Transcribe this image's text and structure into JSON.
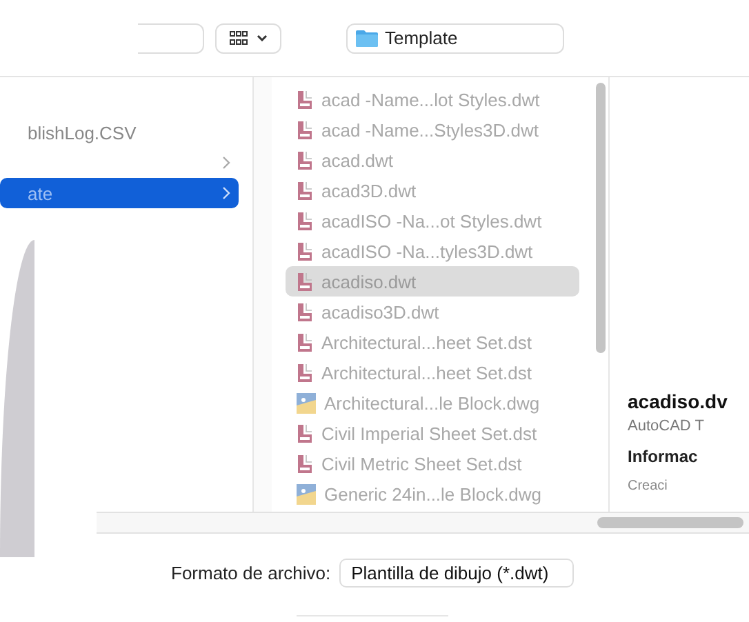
{
  "toolbar": {
    "path": "Template"
  },
  "sidebar_column": {
    "items": [
      {
        "label": "blishLog.CSV",
        "folder": false,
        "selected": false
      },
      {
        "folder": true,
        "selected": false
      },
      {
        "label": "ate",
        "folder": true,
        "selected": true
      }
    ]
  },
  "files": [
    {
      "name": "acad -Name...lot Styles.dwt",
      "kind": "template",
      "selected": false
    },
    {
      "name": "acad -Name...Styles3D.dwt",
      "kind": "template",
      "selected": false
    },
    {
      "name": "acad.dwt",
      "kind": "template",
      "selected": false
    },
    {
      "name": "acad3D.dwt",
      "kind": "template",
      "selected": false
    },
    {
      "name": "acadISO -Na...ot Styles.dwt",
      "kind": "template",
      "selected": false
    },
    {
      "name": "acadISO -Na...tyles3D.dwt",
      "kind": "template",
      "selected": false
    },
    {
      "name": "acadiso.dwt",
      "kind": "template",
      "selected": true
    },
    {
      "name": "acadiso3D.dwt",
      "kind": "template",
      "selected": false
    },
    {
      "name": "Architectural...heet Set.dst",
      "kind": "template",
      "selected": false
    },
    {
      "name": "Architectural...heet Set.dst",
      "kind": "template",
      "selected": false
    },
    {
      "name": "Architectural...le Block.dwg",
      "kind": "drawing",
      "selected": false
    },
    {
      "name": "Civil Imperial Sheet Set.dst",
      "kind": "template",
      "selected": false
    },
    {
      "name": "Civil Metric Sheet Set.dst",
      "kind": "template",
      "selected": false
    },
    {
      "name": "Generic 24in...le Block.dwg",
      "kind": "drawing",
      "selected": false
    }
  ],
  "preview": {
    "title": "acadiso.dv",
    "subtitle": "AutoCAD T",
    "section": "Informac",
    "field": "Creaci"
  },
  "format": {
    "label": "Formato de archivo:",
    "value": "Plantilla de dibujo (*.dwt)"
  }
}
